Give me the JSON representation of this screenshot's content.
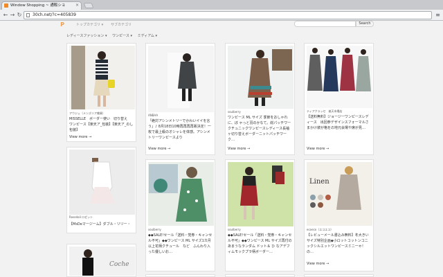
{
  "browser": {
    "tab_title": "Window Shopping ~ 通販ショ",
    "tab_close": "×",
    "url": "30ch.net/?c=405839",
    "back_icon": "arrow-left-icon",
    "forward_icon": "arrow-right-icon",
    "reload_icon": "reload-icon",
    "menu_icon": "hamburger-icon"
  },
  "site": {
    "logo_text": "P",
    "nav": [
      "トップカテゴリ ▾",
      "サブカテゴリ"
    ],
    "search_button": "Search",
    "filters": [
      "レディースファッション ▾",
      "ワンピース ▾",
      "ミディアム ▾"
    ],
    "accent_color": "#f0a050"
  },
  "cards": [
    {
      "shop": "アウジェ（メンズリア雑貨）",
      "desc": "MISSELLE　ボーダー使い　切り替え　ワンピース【楽天ア_包装】【楽天ア_のし包装】",
      "more": "View more →"
    },
    {
      "shop": "Rosedali ロゼット",
      "desc": "【MsDeマージーム】ダブル・リリー・ドレス",
      "more": ""
    },
    {
      "shop": "",
      "desc": "",
      "more": ""
    },
    {
      "shop": "ANBAA",
      "desc": "「絶対アシンメトリーでかわいイイを言う」♪ 8月18日10時再再再再販決定！一枚で最上級のオシャレを体感。アシンメトリーワンピースより",
      "more": "View more →"
    },
    {
      "shop": "soulberry",
      "desc": "◆◆SALE!セール「送料・党券・キャンセル不可」◆◆ワンピース ML サイズ1カ月以上花柄クチュール　など　ふんわり入った優しいお…",
      "more": "View more →"
    },
    {
      "shop": "soulberry",
      "desc": "ワンピース ML サイズ 季節をおしゃれに、ぼ ゃっと羽のかなて。総パッチワークチュニックワンピースレディース長袖ヶ切り替えボーダーニットパッチワーク…",
      "more": "View more →"
    },
    {
      "shop": "soulberry",
      "desc": "◆◆SALE!セール「送料・党券・キャンセル不可」◆◆ワンピース ML サイズ再付のあまうなランダム ドット＆ ひ なアデフィムモックプラ柄ボーダー…",
      "more": "View more →"
    },
    {
      "shop": "ティアクラッセ　楽天市場店",
      "desc": "【送料無料】ジョージーワンピースレディース　出回参デザインスフォーマルさまかけ彼が格をの地元会場や席が見…",
      "more": "View more →"
    },
    {
      "shop": "ecoeco（エコエコ）",
      "desc": "【レビューメール書込み無料】冬大きいサイズ特別企画◆小ロットコットンコニックシルエットワンピースミニ一ゃ！の…",
      "more": "View more →"
    }
  ]
}
